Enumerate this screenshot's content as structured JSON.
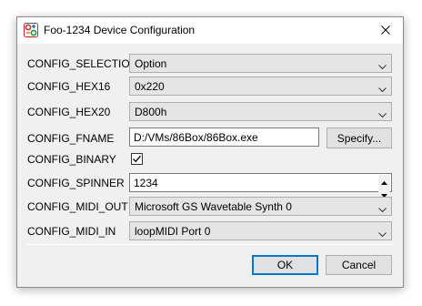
{
  "window": {
    "title": "Foo-1234 Device Configuration",
    "icon": "device-config-icon",
    "close_icon": "close-icon"
  },
  "fields": {
    "selection": {
      "label": "CONFIG_SELECTION",
      "value": "Option"
    },
    "hex16": {
      "label": "CONFIG_HEX16",
      "value": "0x220"
    },
    "hex20": {
      "label": "CONFIG_HEX20",
      "value": "D800h"
    },
    "fname": {
      "label": "CONFIG_FNAME",
      "value": "D:/VMs/86Box/86Box.exe",
      "button": "Specify..."
    },
    "binary": {
      "label": "CONFIG_BINARY",
      "checked": true
    },
    "spinner": {
      "label": "CONFIG_SPINNER",
      "value": "1234"
    },
    "midi_out": {
      "label": "CONFIG_MIDI_OUT",
      "value": "Microsoft GS Wavetable Synth 0"
    },
    "midi_in": {
      "label": "CONFIG_MIDI_IN",
      "value": "loopMIDI Port 0"
    }
  },
  "buttons": {
    "ok": "OK",
    "cancel": "Cancel"
  },
  "colors": {
    "accent": "#0078d7",
    "window_bg": "#f0f0f0",
    "combo_bg": "#e5e5e5"
  }
}
